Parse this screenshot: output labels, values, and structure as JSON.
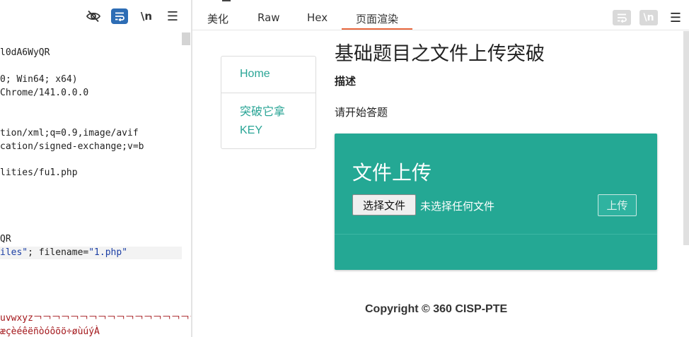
{
  "left_toolbar": {
    "eye_icon": "eye-slash-icon",
    "wrap_icon": "wrap-icon",
    "newline_label": "\\n",
    "menu_glyph": "☰"
  },
  "code": {
    "line1": "l0dA6WyQR",
    "line2": "0; Win64; x64)",
    "line3": "Chrome/141.0.0.0",
    "line4": "tion/xml;q=0.9,image/avif",
    "line5": "cation/signed-exchange;v=b",
    "line6": "lities/fu1.php",
    "line7": "QR",
    "line8_str1": "iles\"",
    "line8_mid": "; filename=",
    "line8_str2": "\"1.php\"",
    "line9": "uvwxyz￢￢￢￢￢￢￢￢￢￢￢￢￢￢￢￢￢￢¢£",
    "line10": "æçèéêëñòóôõö÷øùúýÀ"
  },
  "tabs": {
    "beautify": "美化",
    "raw": "Raw",
    "hex": "Hex",
    "render": "页面渲染",
    "newline_label": "\\n",
    "menu_glyph": "☰",
    "accent": "#e8663d"
  },
  "page": {
    "nav_home": "Home",
    "nav_key": "突破它拿KEY",
    "title": "基础题目之文件上传突破",
    "desc_heading": "描述",
    "desc_text": "请开始答题",
    "panel_title": "文件上传",
    "choose_button": "选择文件",
    "no_file": "未选择任何文件",
    "upload_button": "上传",
    "copyright": "Copyright © 360 CISP-PTE",
    "panel_color": "#24a894",
    "link_color": "#2aa596"
  }
}
